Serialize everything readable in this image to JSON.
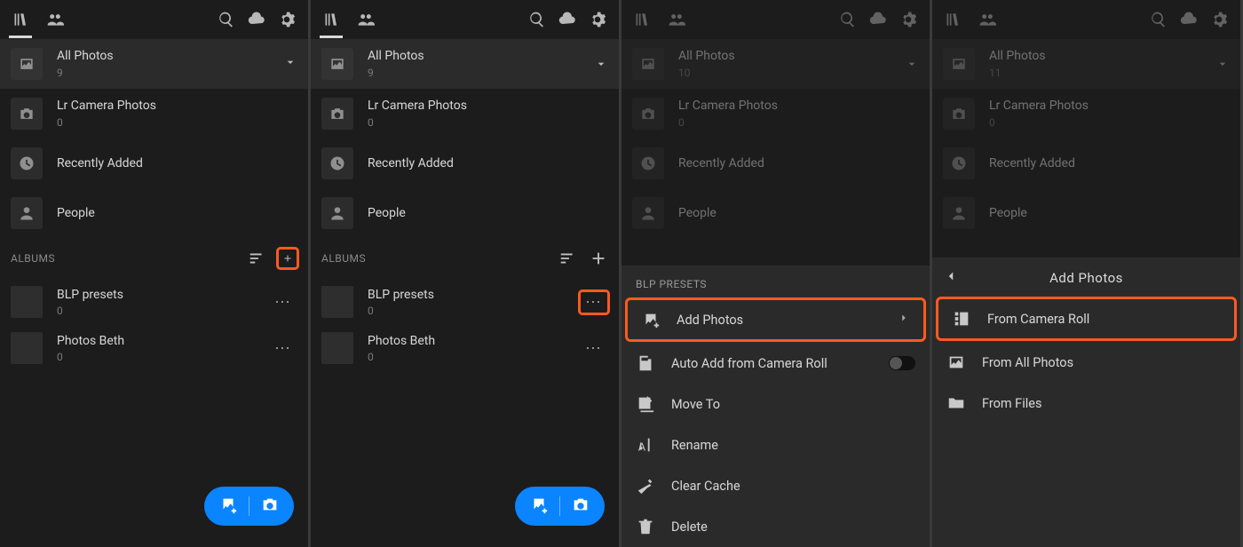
{
  "panels": [
    {
      "allPhotos": {
        "title": "All Photos",
        "count": "9"
      },
      "lrCam": {
        "title": "Lr Camera Photos",
        "count": "0"
      },
      "recent": {
        "title": "Recently Added"
      },
      "people": {
        "title": "People"
      },
      "albumsHeader": "ALBUMS",
      "albums": [
        {
          "title": "BLP presets",
          "count": "0"
        },
        {
          "title": "Photos Beth",
          "count": "0"
        }
      ]
    },
    {
      "allPhotos": {
        "title": "All Photos",
        "count": "9"
      },
      "lrCam": {
        "title": "Lr Camera Photos",
        "count": "0"
      },
      "recent": {
        "title": "Recently Added"
      },
      "people": {
        "title": "People"
      },
      "albumsHeader": "ALBUMS",
      "albums": [
        {
          "title": "BLP presets",
          "count": "0"
        },
        {
          "title": "Photos Beth",
          "count": "0"
        }
      ]
    },
    {
      "allPhotos": {
        "title": "All Photos",
        "count": "10"
      },
      "lrCam": {
        "title": "Lr Camera Photos",
        "count": "0"
      },
      "recent": {
        "title": "Recently Added"
      },
      "people": {
        "title": "People"
      },
      "sheet": {
        "head": "BLP PRESETS",
        "items": {
          "addPhotos": "Add Photos",
          "autoAdd": "Auto Add from Camera Roll",
          "moveTo": "Move To",
          "rename": "Rename",
          "clearCache": "Clear Cache",
          "delete": "Delete"
        }
      }
    },
    {
      "allPhotos": {
        "title": "All Photos",
        "count": "11"
      },
      "lrCam": {
        "title": "Lr Camera Photos",
        "count": "0"
      },
      "recent": {
        "title": "Recently Added"
      },
      "people": {
        "title": "People"
      },
      "sheet": {
        "head": "Add Photos",
        "items": {
          "fromCameraRoll": "From Camera Roll",
          "fromAllPhotos": "From All Photos",
          "fromFiles": "From Files"
        }
      }
    }
  ]
}
